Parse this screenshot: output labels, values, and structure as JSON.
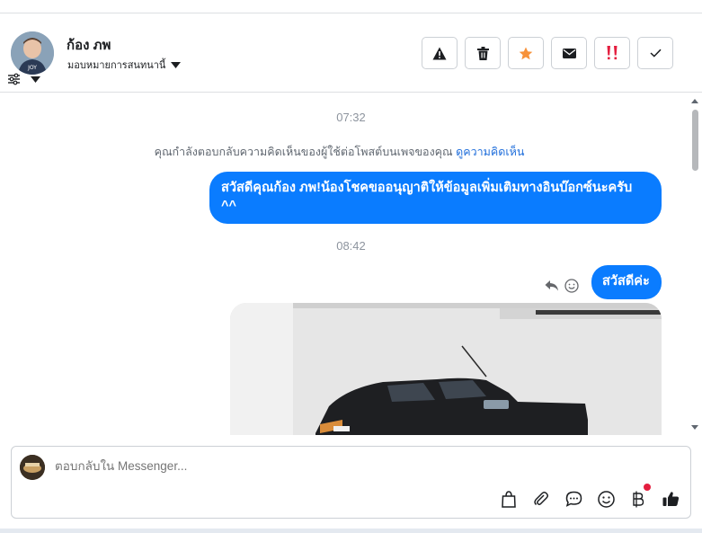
{
  "contact": {
    "name": "ก้อง ภพ",
    "assign_label": "มอบหมายการสนทนานี้"
  },
  "toolbar": {
    "buttons": [
      {
        "name": "report",
        "icon": "warning-icon"
      },
      {
        "name": "delete",
        "icon": "trash-icon"
      },
      {
        "name": "star",
        "icon": "star-icon",
        "color": "#f7923a"
      },
      {
        "name": "mark-unread",
        "icon": "envelope-icon"
      },
      {
        "name": "follow-up",
        "icon": "double-exclamation-icon",
        "color": "#e41e3f"
      },
      {
        "name": "done",
        "icon": "check-icon"
      }
    ]
  },
  "messages": {
    "time1": "07:32",
    "notice_text": "คุณกำลังตอบกลับความคิดเห็นของผู้ใช้ต่อโพสต์บนเพจของคุณ",
    "notice_link": "ดูความคิดเห็น",
    "bubble1": "สวัสดีคุณก้อง ภพ!น้องโชคขออนุญาติให้ข้อมูลเพิ่มเติมทางอินบ๊อกซ์นะครับ ^^",
    "time2": "08:42",
    "bubble2": "สวัสดีค่ะ"
  },
  "composer": {
    "placeholder": "ตอบกลับใน Messenger...",
    "icons": [
      "bag-icon",
      "paperclip-icon",
      "chat-icon",
      "emoji-icon",
      "baht-icon",
      "thumbs-up-icon"
    ]
  },
  "colors": {
    "accent": "#0a7cff",
    "link": "#216fdb",
    "star": "#f7923a",
    "alert": "#e41e3f"
  }
}
